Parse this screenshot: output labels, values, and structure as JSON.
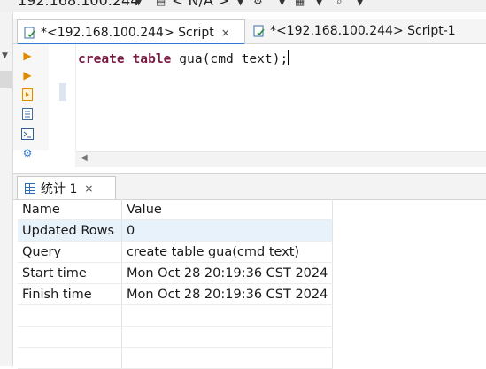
{
  "toolbar": {
    "connection": "192.168.100.244",
    "schema": "< N/A >"
  },
  "editor_tabs": [
    {
      "label": "*<192.168.100.244> Script",
      "close": "×"
    },
    {
      "label": "*<192.168.100.244> Script-1"
    }
  ],
  "editor": {
    "kw_create": "create",
    "kw_table": "table",
    "table_name": "gua",
    "open_paren": "(",
    "col_name": "cmd",
    "col_type": "text",
    "close": ");"
  },
  "results": {
    "tab_label": "统计 1",
    "tab_close": "×",
    "columns": [
      "Name",
      "Value"
    ],
    "rows": [
      {
        "name": "Updated Rows",
        "value": "0"
      },
      {
        "name": "Query",
        "value": "create table gua(cmd text)"
      },
      {
        "name": "Start time",
        "value": "Mon Oct 28 20:19:36 CST 2024"
      },
      {
        "name": "Finish time",
        "value": "Mon Oct 28 20:19:36 CST 2024"
      }
    ]
  },
  "colors": {
    "keyword": "#7a1a42",
    "accent": "#2f7bd6",
    "highlight_row": "#e8f2fb"
  }
}
